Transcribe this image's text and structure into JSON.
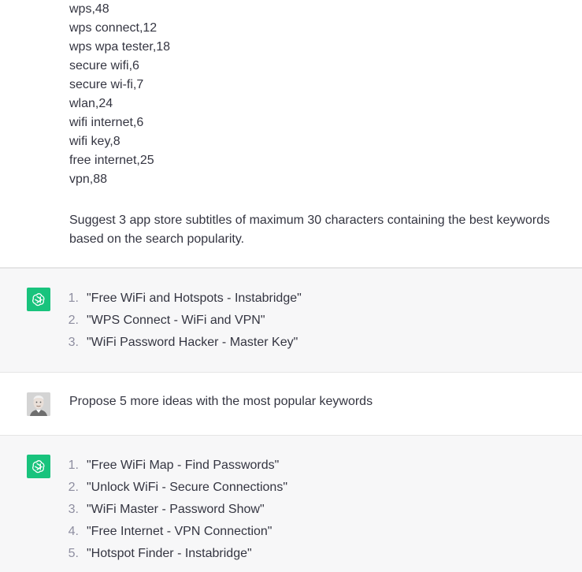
{
  "conversation": {
    "prompt_message": {
      "keyword_lines": [
        "wps,48",
        "wps connect,12",
        "wps wpa tester,18",
        "secure wifi,6",
        "secure wi-fi,7",
        "wlan,24",
        "wifi internet,6",
        "wifi key,8",
        "free internet,25",
        "vpn,88"
      ],
      "instruction": "Suggest 3 app store subtitles of maximum 30 characters containing the best keywords based on the search popularity."
    },
    "response_1": {
      "items": [
        {
          "number": "1.",
          "text": "\"Free WiFi and Hotspots - Instabridge\""
        },
        {
          "number": "2.",
          "text": "\"WPS Connect - WiFi and VPN\""
        },
        {
          "number": "3.",
          "text": "\"WiFi Password Hacker - Master Key\""
        }
      ]
    },
    "user_message_2": {
      "text": "Propose 5 more ideas with the most popular keywords"
    },
    "response_2": {
      "items": [
        {
          "number": "1.",
          "text": "\"Free WiFi Map - Find Passwords\""
        },
        {
          "number": "2.",
          "text": "\"Unlock WiFi - Secure Connections\""
        },
        {
          "number": "3.",
          "text": "\"WiFi Master - Password Show\""
        },
        {
          "number": "4.",
          "text": "\"Free Internet - VPN Connection\""
        },
        {
          "number": "5.",
          "text": "\"Hotspot Finder - Instabridge\""
        }
      ]
    }
  },
  "icons": {
    "assistant_avatar": "openai-logo-icon",
    "user_avatar": "user-photo-avatar"
  },
  "colors": {
    "assistant_bg": "#f7f7f8",
    "assistant_avatar_bg": "#19c37d",
    "text": "#343541",
    "list_number": "#8e8ea0"
  }
}
